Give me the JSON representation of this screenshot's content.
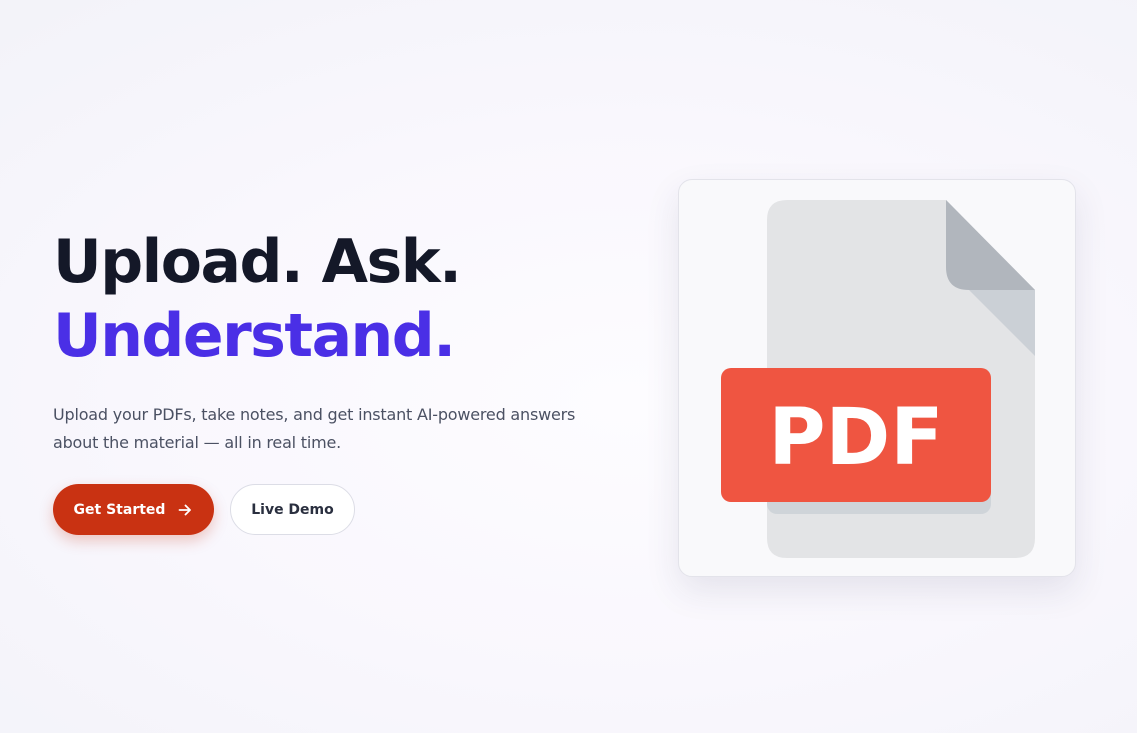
{
  "hero": {
    "headline_line1": "Upload. Ask.",
    "headline_line2": "Understand.",
    "subtitle": "Upload your PDFs, take notes, and get instant AI-powered answers about the material — all in real time."
  },
  "cta": {
    "primary_label": "Get Started",
    "primary_icon": "arrow-right-icon",
    "secondary_label": "Live Demo"
  },
  "preview": {
    "badge_text": "PDF",
    "icon": "pdf-file-icon"
  },
  "colors": {
    "heading": "#141828",
    "accent": "#4a2fe6",
    "primary_button": "#c93212",
    "pdf_badge": "#ef5541",
    "text_muted": "#4b5163"
  }
}
